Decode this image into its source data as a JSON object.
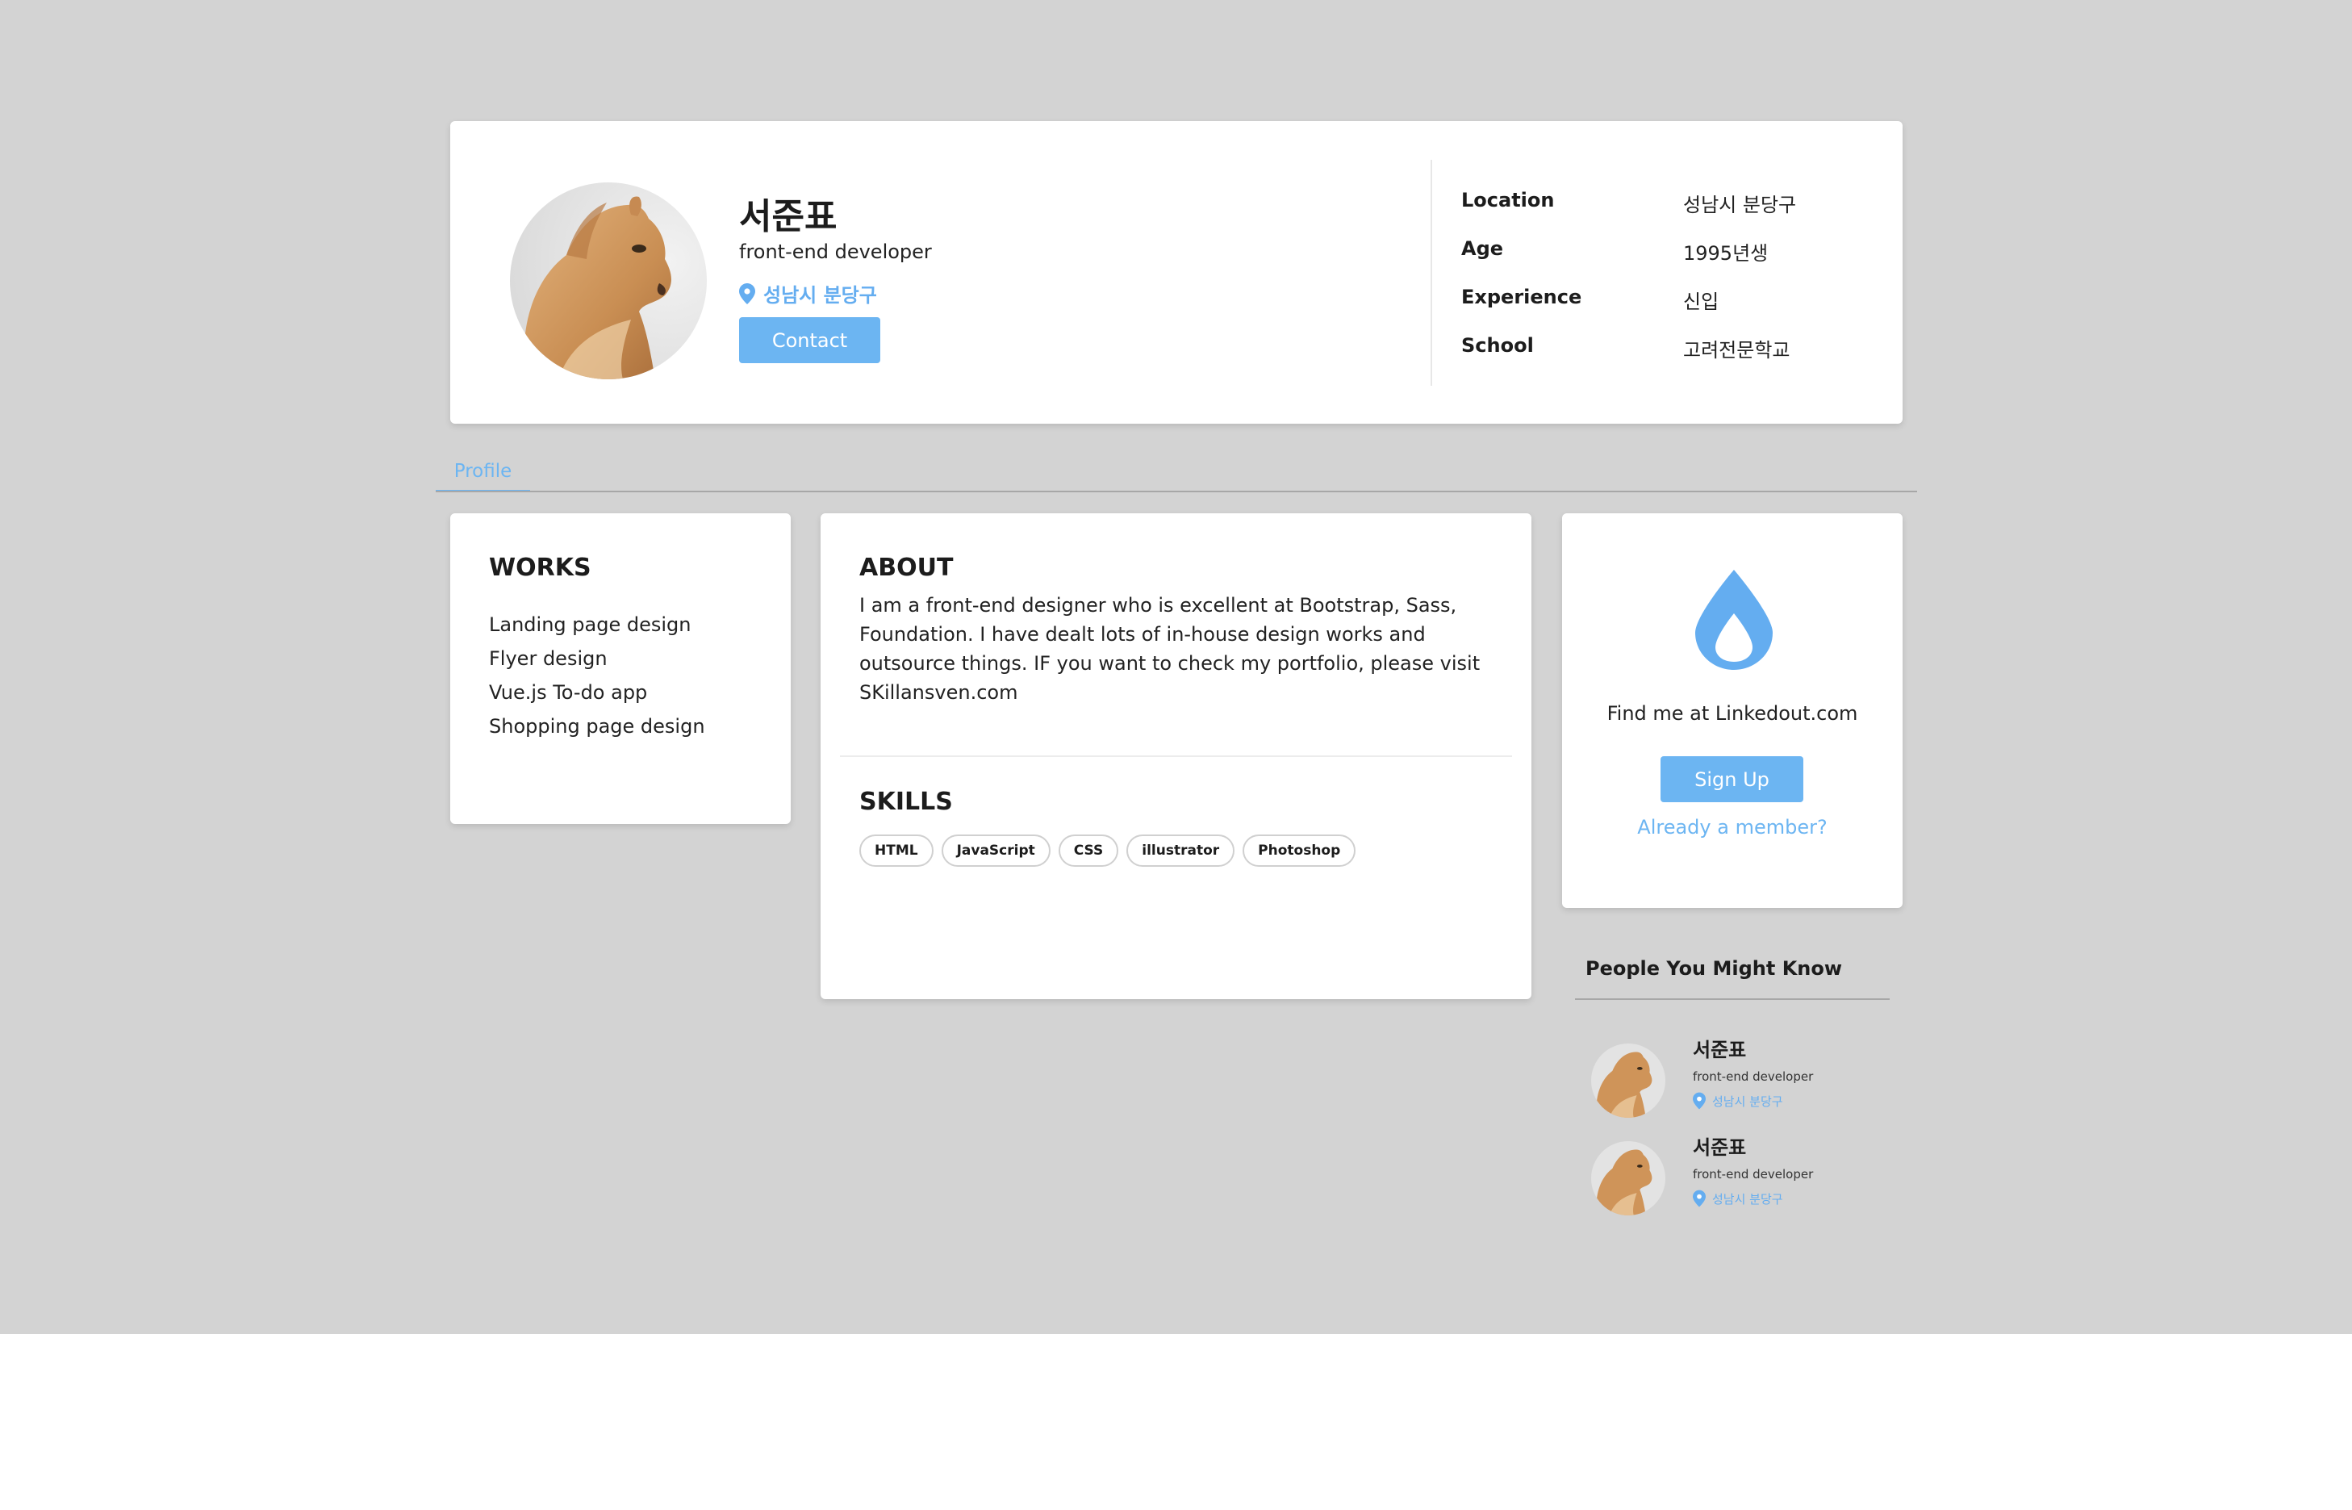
{
  "profile": {
    "name": "서준표",
    "role": "front-end developer",
    "location": "성남시 분당구",
    "contact_label": "Contact"
  },
  "info": [
    {
      "label": "Location",
      "value": "성남시 분당구"
    },
    {
      "label": "Age",
      "value": "1995년생"
    },
    {
      "label": "Experience",
      "value": "신입"
    },
    {
      "label": "School",
      "value": "고려전문학교"
    }
  ],
  "tabs": [
    {
      "label": "Profile"
    }
  ],
  "works": {
    "title": "WORKS",
    "items": [
      "Landing page design",
      "Flyer design",
      "Vue.js To-do app",
      "Shopping page design"
    ]
  },
  "about": {
    "title": "ABOUT",
    "text": "I am a front-end designer who is excellent at Bootstrap, Sass, Foundation. I have dealt lots of in-house design works and outsource things. IF you want to check my portfolio, please visit SKillansven.com"
  },
  "skills": {
    "title": "SKILLS",
    "items": [
      "HTML",
      "JavaScript",
      "CSS",
      "illustrator",
      "Photoshop"
    ]
  },
  "signup_card": {
    "icon": "water-drop-icon",
    "text": "Find me at Linkedout.com",
    "button_label": "Sign Up",
    "link_label": "Already a member?"
  },
  "people": {
    "title": "People You Might Know",
    "items": [
      {
        "name": "서준표",
        "role": "front-end developer",
        "location": "성남시 분당구"
      },
      {
        "name": "서준표",
        "role": "front-end developer",
        "location": "성남시 분당구"
      }
    ]
  },
  "colors": {
    "accent": "#6cb5f2",
    "background": "#d3d3d3",
    "card": "#ffffff"
  }
}
